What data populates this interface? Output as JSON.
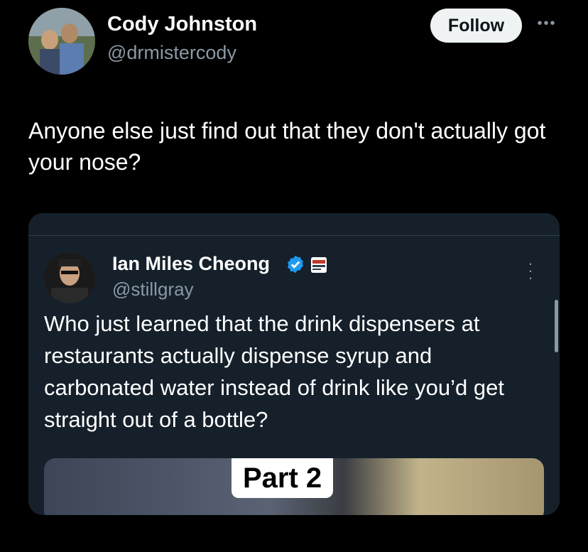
{
  "author": {
    "name": "Cody Johnston",
    "handle": "@drmistercody",
    "follow_label": "Follow"
  },
  "tweet": {
    "text": "Anyone else just find out that they don't actually got your nose?"
  },
  "quoted": {
    "name": "Ian Miles Cheong",
    "handle": "@stillgray",
    "text": "Who just learned that the drink dispensers at restaurants actually dispense syrup and carbonated water instead of drink like you’d get straight out of a bottle?",
    "media_label": "Part 2"
  },
  "icons": {
    "more_top": "more-horizontal-icon",
    "more_quote": "more-vertical-icon",
    "verified": "verified-badge-icon",
    "affiliate": "affiliate-badge-icon"
  },
  "colors": {
    "background": "#000000",
    "card": "#15202b",
    "muted": "#8b98a5",
    "verified": "#1d9bf0",
    "follow_bg": "#eff3f4"
  }
}
